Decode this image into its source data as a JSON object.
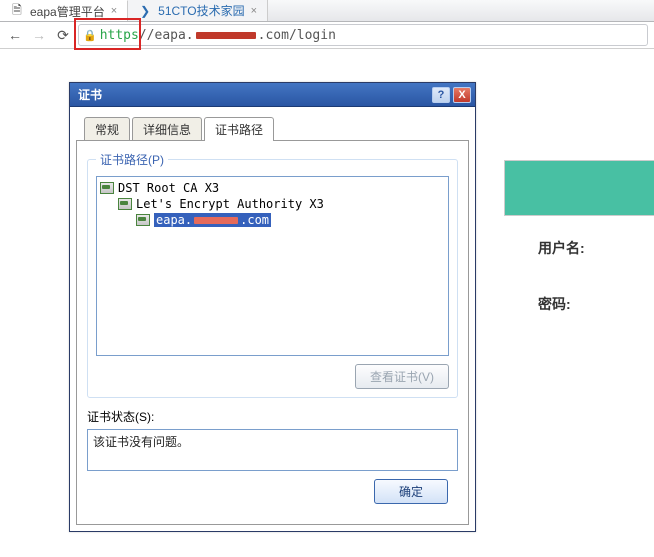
{
  "browser": {
    "tabs": [
      {
        "title": "eapa管理平台",
        "active": true,
        "favicon": "page"
      },
      {
        "title": "51CTO技术家园",
        "active": false,
        "favicon": "51cto"
      }
    ],
    "url": {
      "scheme": "https",
      "prefix": "//eapa.",
      "redacted": "",
      "suffix": ".com/login"
    }
  },
  "page_behind": {
    "username_label": "用户名:",
    "password_label": "密码:"
  },
  "dialog": {
    "title": "证书",
    "help": "?",
    "close": "X",
    "tabs": {
      "general": "常规",
      "details": "详细信息",
      "path": "证书路径"
    },
    "path_section": {
      "legend": "证书路径(P)",
      "tree": {
        "root": "DST Root CA X3",
        "intermediate": "Let's Encrypt Authority X3",
        "leaf_prefix": "eapa.",
        "leaf_suffix": ".com"
      },
      "view_cert_btn": "查看证书(V)"
    },
    "status_section": {
      "label": "证书状态(S):",
      "text": "该证书没有问题。"
    },
    "ok_btn": "确定"
  }
}
